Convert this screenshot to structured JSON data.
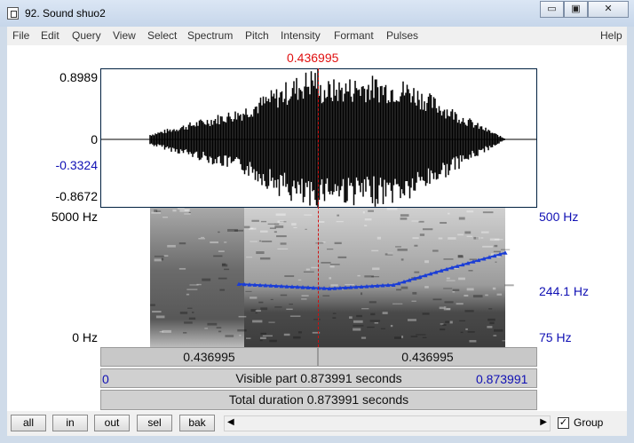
{
  "window": {
    "title": "92. Sound shuo2",
    "btn_min": "▭",
    "btn_max": "▣",
    "btn_close": "✕"
  },
  "menu": [
    "File",
    "Edit",
    "Query",
    "View",
    "Select",
    "Spectrum",
    "Pitch",
    "Intensity",
    "Formant",
    "Pulses",
    "Help"
  ],
  "cursor_time": "0.436995",
  "waveform": {
    "max": "0.8989",
    "zero": "0",
    "cursor_value": "-0.3324",
    "min": "-0.8672"
  },
  "spectrogram": {
    "freq_top": "5000 Hz",
    "freq_bottom": "0 Hz",
    "pitch_top": "500 Hz",
    "pitch_cursor": "244.1 Hz",
    "pitch_bottom": "75 Hz"
  },
  "bars": {
    "left_segment": "0.436995",
    "right_segment": "0.436995",
    "visible_start": "0",
    "visible_label": "Visible part 0.873991 seconds",
    "visible_end": "0.873991",
    "total_label": "Total duration 0.873991 seconds"
  },
  "toolbar": {
    "all": "all",
    "in": "in",
    "out": "out",
    "sel": "sel",
    "bak": "bak",
    "group": "Group",
    "group_checked": true
  },
  "colors": {
    "pitch": "#1a3dd6",
    "cursor": "#d01010",
    "axis_blue": "#1010b4"
  }
}
